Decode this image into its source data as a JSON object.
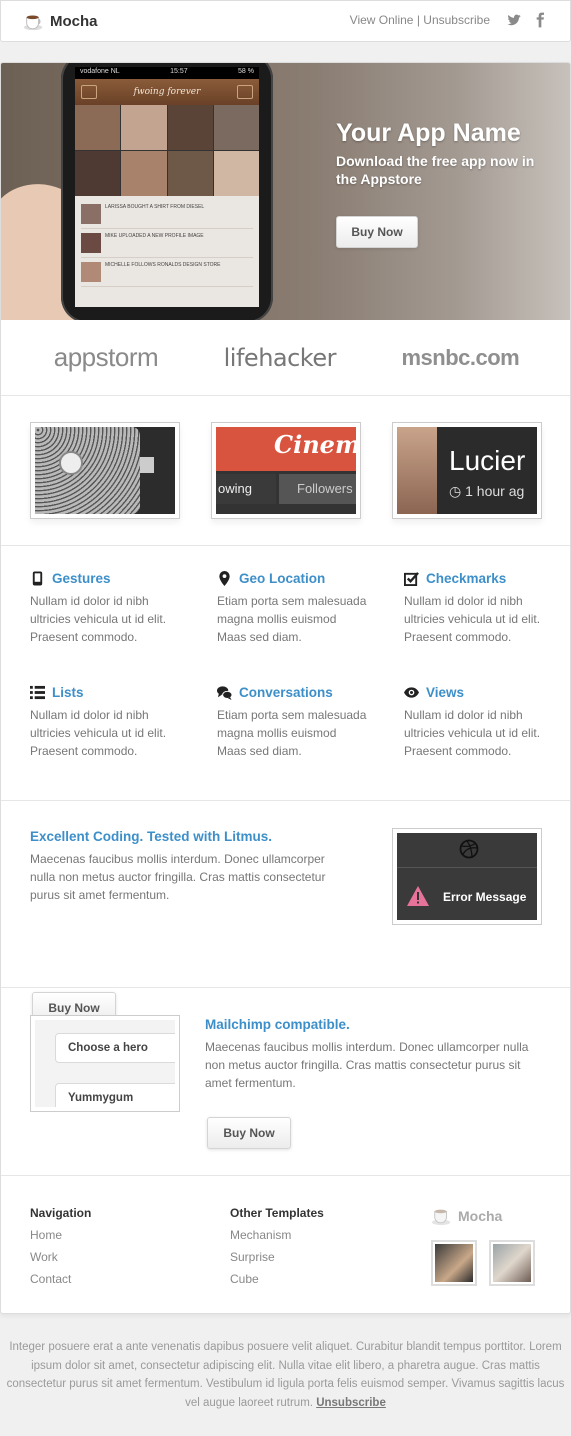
{
  "header": {
    "brand": "Mocha",
    "view_online": "View Online",
    "separator": "|",
    "unsubscribe": "Unsubscribe"
  },
  "hero": {
    "title": "Your App Name",
    "subtitle": "Download the free app now in the Appstore",
    "button": "Buy Now",
    "phone": {
      "carrier": "vodafone NL",
      "time": "15:57",
      "battery": "58 %",
      "app_title": "fwoing forever",
      "feed": [
        {
          "text": "LARISSA BOUGHT A SHIRT FROM DIESEL"
        },
        {
          "text": "MIKE UPLOADED A NEW PROFILE IMAGE"
        },
        {
          "text": "MICHELLE FOLLOWS RONALDS DESIGN STORE"
        }
      ]
    }
  },
  "press": {
    "logos": [
      "appstorm",
      "lifehacker",
      "msnbc.com"
    ]
  },
  "shots": {
    "cinema_word": "Cinemat",
    "tab_left": "owing",
    "tab_right": "Followers",
    "name": "Lucier",
    "time_ago": "1 hour ag"
  },
  "features": [
    {
      "title": "Gestures",
      "icon": "mobile-phone-icon",
      "text": "Nullam id dolor id nibh ultricies vehicula ut id elit. Praesent commodo."
    },
    {
      "title": "Geo Location",
      "icon": "map-pin-icon",
      "text": "Etiam porta sem malesuada magna mollis euismod Maas sed diam."
    },
    {
      "title": "Checkmarks",
      "icon": "checkbox-icon",
      "text": "Nullam id dolor id nibh ultricies vehicula ut id elit. Praesent commodo."
    },
    {
      "title": "Lists",
      "icon": "list-icon",
      "text": "Nullam id dolor id nibh ultricies vehicula ut id elit. Praesent commodo."
    },
    {
      "title": "Conversations",
      "icon": "chat-bubbles-icon",
      "text": "Etiam porta sem malesuada magna mollis euismod Maas sed diam."
    },
    {
      "title": "Views",
      "icon": "eye-icon",
      "text": "Nullam id dolor id nibh ultricies vehicula ut id elit. Praesent commodo."
    }
  ],
  "coding": {
    "title": "Excellent Coding. Tested with Litmus.",
    "text": "Maecenas faucibus mollis interdum. Donec ullamcorper nulla non metus auctor fringilla. Cras mattis consectetur purus sit amet fermentum.",
    "button": "Buy Now",
    "error_label": "Error Message"
  },
  "mailchimp": {
    "title": "Mailchimp compatible.",
    "text": "Maecenas faucibus mollis interdum. Donec ullamcorper nulla non metus auctor fringilla. Cras mattis consectetur purus sit amet fermentum.",
    "button": "Buy Now",
    "pill_1": "Choose a hero",
    "pill_2": "Yummygum"
  },
  "footer": {
    "nav_heading": "Navigation",
    "nav": [
      "Home",
      "Work",
      "Contact"
    ],
    "templates_heading": "Other Templates",
    "templates": [
      "Mechanism",
      "Surprise",
      "Cube"
    ],
    "brand": "Mocha"
  },
  "legal": {
    "text": "Integer posuere erat a ante venenatis dapibus posuere velit aliquet. Curabitur blandit tempus porttitor. Lorem ipsum dolor sit amet, consectetur adipiscing elit. Nulla vitae elit libero, a pharetra augue. Cras mattis consectetur purus sit amet fermentum. Vestibulum id ligula porta felis euismod semper. Vivamus sagittis lacus vel augue laoreet rutrum.",
    "unsubscribe": "Unsubscribe"
  },
  "colors": {
    "accent": "#3d8fc9",
    "background": "#f0f0f0"
  }
}
